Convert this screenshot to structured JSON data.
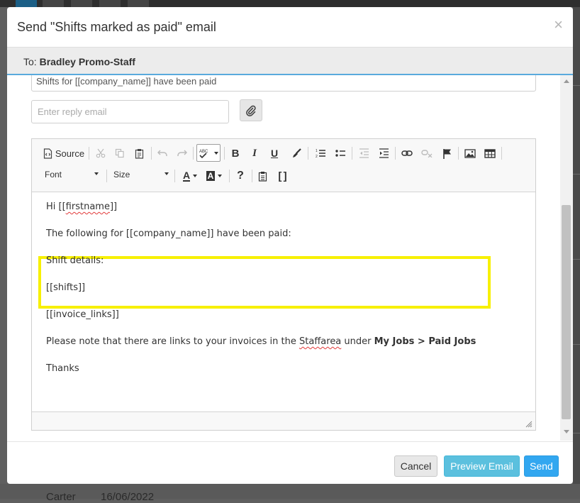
{
  "modal": {
    "title": "Send \"Shifts marked as paid\" email",
    "close_symbol": "×",
    "to_prefix": "To: ",
    "to_name": "Bradley Promo-Staff"
  },
  "form": {
    "subject_value": "Shifts for [[company_name]] have been paid",
    "reply_placeholder": "Enter reply email"
  },
  "toolbar": {
    "source_label": "Source",
    "bold": "B",
    "italic": "I",
    "underline": "U",
    "help": "?",
    "brackets": "[ ]",
    "font_label": "Font",
    "size_label": "Size",
    "text_color_letter": "A",
    "bg_color_letter": "A",
    "spell_label": "ABC"
  },
  "body": {
    "greeting_prefix": "Hi [[",
    "greeting_var": "firstname",
    "greeting_suffix": "]]",
    "line_following": "The following for [[company_name]] have been paid:",
    "line_shift_details": "Shift details:",
    "line_shifts": "[[shifts]]",
    "line_invoice_links": "[[invoice_links]]",
    "note_prefix": "Please note that there are links to your invoices in the ",
    "note_staffarea": "Staffarea",
    "note_under": " under ",
    "note_path": "My Jobs > Paid Jobs",
    "line_thanks": "Thanks"
  },
  "footer": {
    "cancel_label": "Cancel",
    "preview_label": "Preview Email",
    "send_label": "Send"
  },
  "background": {
    "row_name": "Carter",
    "row_date": "16/06/2022"
  },
  "colors": {
    "highlight": "#f7f000",
    "primary": "#32a7f0",
    "info": "#5bc0de",
    "to_bar_border": "#5aaadd",
    "spell_underline": "#e23a3a"
  }
}
